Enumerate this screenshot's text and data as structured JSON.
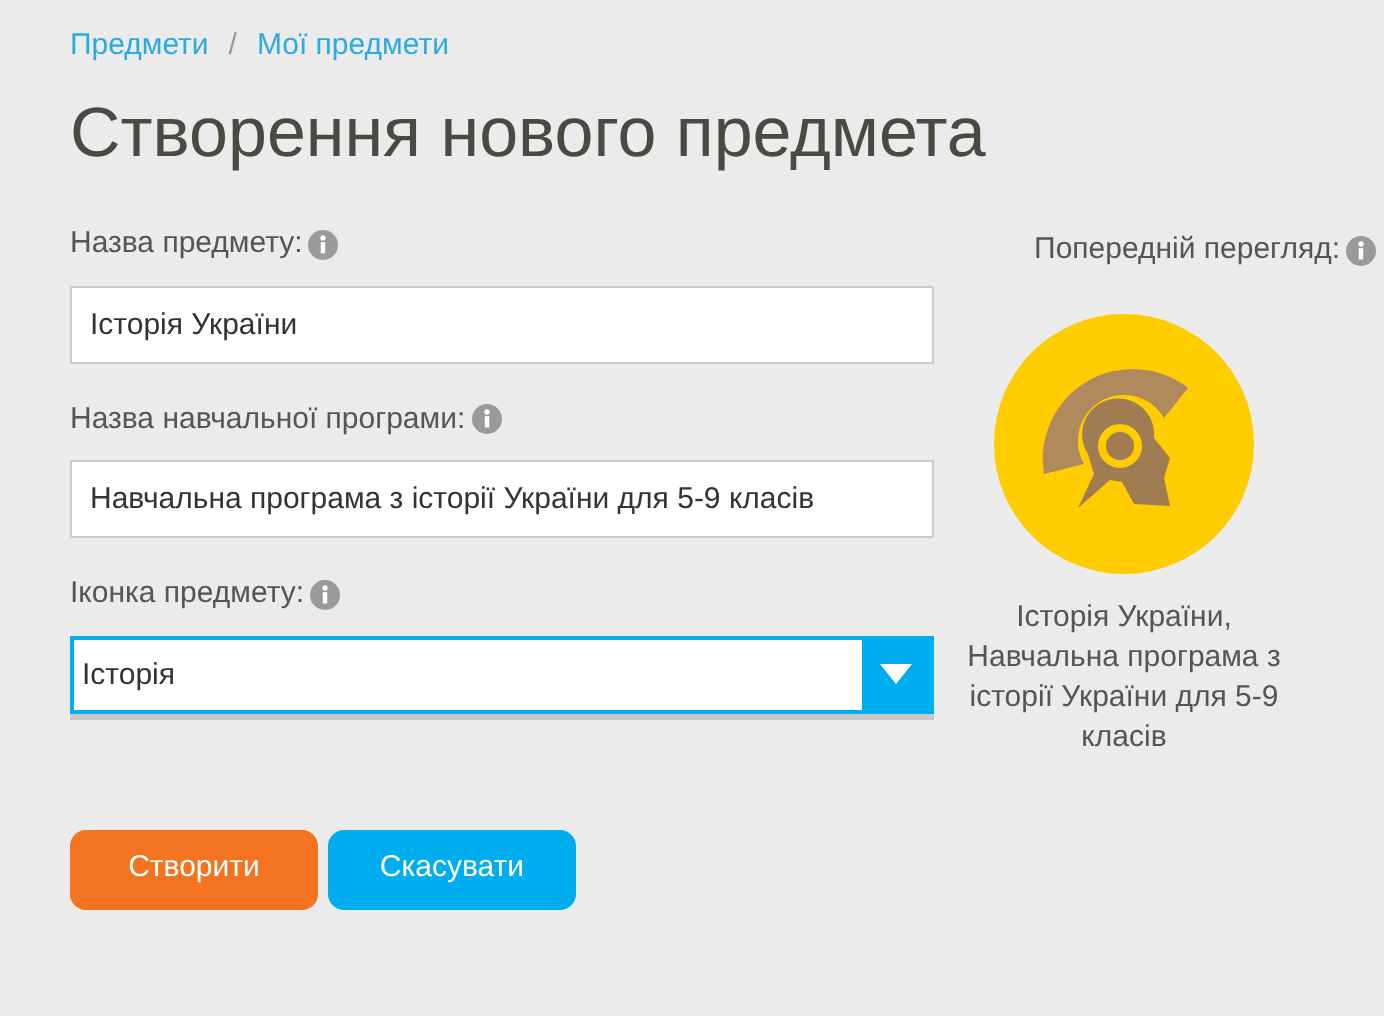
{
  "breadcrumb": [
    {
      "label": "Предмети"
    },
    {
      "label": "Мої предмети"
    }
  ],
  "breadcrumb_separator": "/",
  "title": "Створення нового предмета",
  "fields": [
    {
      "kind": "text",
      "label": "Назва предмету:",
      "value": "Історія України"
    },
    {
      "kind": "text",
      "label": "Назва навчальної програми:",
      "value": "Навчальна програма з історії України для 5-9 класів"
    },
    {
      "kind": "select",
      "label": "Іконка предмету:",
      "value": "Історія"
    }
  ],
  "buttons": [
    {
      "label": "Створити",
      "kind": "primary"
    },
    {
      "label": "Скасувати",
      "kind": "secondary"
    }
  ],
  "preview": {
    "label": "Попередній перегляд:",
    "caption": "Історія України, Навчальна програма з історії України для 5-9 класів"
  }
}
